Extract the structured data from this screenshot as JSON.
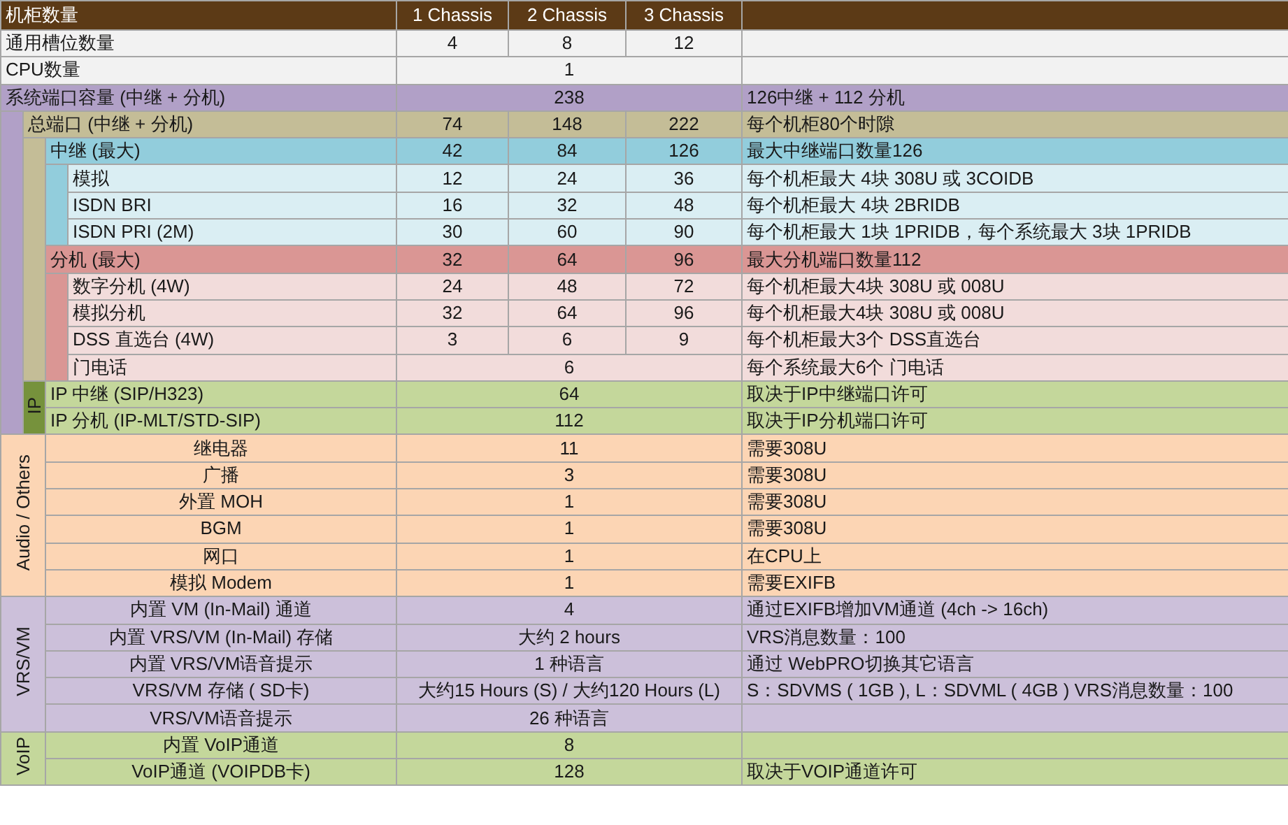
{
  "header": {
    "title": "机柜数量",
    "columns": [
      "1 Chassis",
      "2 Chassis",
      "3 Chassis"
    ]
  },
  "rows": [
    {
      "label": "通用槽位数量",
      "values": [
        "4",
        "8",
        "12"
      ],
      "color": "#f2f2f2"
    },
    {
      "label": "CPU数量",
      "values": [
        "1"
      ],
      "color": "#f2f2f2"
    },
    {
      "label": "系统端口容量 (中继 + 分机)",
      "values": [
        "238"
      ],
      "note": "126中继  + 112 分机",
      "color": "#b1a0c7",
      "children": [
        {
          "label": "总端口 (中继 + 分机)",
          "values": [
            "74",
            "148",
            "222"
          ],
          "note": "每个机柜80个时隙",
          "color": "#c4bd97",
          "children": [
            {
              "label": "中继 (最大)",
              "values": [
                "42",
                "84",
                "126"
              ],
              "note": "最大中继端口数量126",
              "color": "#92cddc",
              "children": [
                {
                  "label": "模拟",
                  "values": [
                    "12",
                    "24",
                    "36"
                  ],
                  "note": "每个机柜最大  4块 308U 或 3COIDB",
                  "color": "#daeef3"
                },
                {
                  "label": "ISDN BRI",
                  "values": [
                    "16",
                    "32",
                    "48"
                  ],
                  "note": "每个机柜最大  4块 2BRIDB",
                  "color": "#daeef3"
                },
                {
                  "label": "ISDN PRI (2M)",
                  "values": [
                    "30",
                    "60",
                    "90"
                  ],
                  "note": "每个机柜最大  1块 1PRIDB，每个系统最大  3块 1PRIDB",
                  "color": "#daeef3"
                }
              ]
            },
            {
              "label": "分机 (最大)",
              "values": [
                "32",
                "64",
                "96"
              ],
              "note": "最大分机端口数量112",
              "color": "#da9694",
              "children": [
                {
                  "label": "数字分机 (4W)",
                  "values": [
                    "24",
                    "48",
                    "72"
                  ],
                  "note": "每个机柜最大4块  308U 或 008U",
                  "color": "#f2dcdb"
                },
                {
                  "label": "模拟分机",
                  "values": [
                    "32",
                    "64",
                    "96"
                  ],
                  "note": "每个机柜最大4块  308U 或 008U",
                  "color": "#f2dcdb"
                },
                {
                  "label": "DSS 直选台 (4W)",
                  "values": [
                    "3",
                    "6",
                    "9"
                  ],
                  "note": "每个机柜最大3个  DSS直选台",
                  "color": "#f2dcdb"
                },
                {
                  "label": "门电话",
                  "values": [
                    "6"
                  ],
                  "note": "每个系统最大6个  门电话",
                  "color": "#f2dcdb"
                }
              ]
            }
          ]
        },
        {
          "kind": "group",
          "band_label": "IP",
          "color": "#76923c",
          "children": [
            {
              "label": "IP 中继 (SIP/H323)",
              "values": [
                "64"
              ],
              "note": "取决于IP中继端口许可",
              "color": "#c4d79b"
            },
            {
              "label": "IP 分机 (IP-MLT/STD-SIP)",
              "values": [
                "112"
              ],
              "note": "取决于IP分机端口许可",
              "color": "#c4d79b"
            }
          ]
        }
      ]
    },
    {
      "kind": "section",
      "band_label": "Audio / Others",
      "color": "#fcd5b4",
      "children": [
        {
          "label": "继电器",
          "values": [
            "11"
          ],
          "note": "需要308U",
          "color": "#fcd5b4"
        },
        {
          "label": "广播",
          "values": [
            "3"
          ],
          "note": "需要308U",
          "color": "#fcd5b4"
        },
        {
          "label": "外置 MOH",
          "values": [
            "1"
          ],
          "note": "需要308U",
          "color": "#fcd5b4"
        },
        {
          "label": "BGM",
          "values": [
            "1"
          ],
          "note": "需要308U",
          "color": "#fcd5b4"
        },
        {
          "label": "网口",
          "values": [
            "1"
          ],
          "note": "在CPU上",
          "color": "#fcd5b4"
        },
        {
          "label": "模拟 Modem",
          "values": [
            "1"
          ],
          "note": "需要EXIFB",
          "color": "#fcd5b4"
        }
      ]
    },
    {
      "kind": "section",
      "band_label": "VRS/VM",
      "color": "#ccc0da",
      "children": [
        {
          "label": "内置 VM (In-Mail) 通道",
          "values": [
            "4"
          ],
          "note": "通过EXIFB增加VM通道 (4ch -> 16ch)",
          "color": "#ccc0da"
        },
        {
          "label": "内置 VRS/VM (In-Mail) 存储",
          "values": [
            "大约 2 hours"
          ],
          "note": "VRS消息数量：100",
          "color": "#ccc0da"
        },
        {
          "label": "内置 VRS/VM语音提示",
          "values": [
            "1 种语言"
          ],
          "note": "通过 WebPRO切换其它语言",
          "color": "#ccc0da"
        },
        {
          "label": "VRS/VM 存储 ( SD卡)",
          "values": [
            "大约15 Hours (S) / 大约120 Hours (L)"
          ],
          "note": "S：SDVMS ( 1GB ), L：SDVML ( 4GB )    VRS消息数量：100",
          "color": "#ccc0da"
        },
        {
          "label": "VRS/VM语音提示",
          "values": [
            "26 种语言"
          ],
          "color": "#ccc0da"
        }
      ]
    },
    {
      "kind": "section",
      "band_label": "VoIP",
      "color": "#c4d79b",
      "children": [
        {
          "label": "内置 VoIP通道",
          "values": [
            "8"
          ],
          "color": "#c4d79b"
        },
        {
          "label": "VoIP通道 (VOIPDB卡)",
          "values": [
            "128"
          ],
          "note": "取决于VOIP通道许可",
          "color": "#c4d79b"
        }
      ]
    }
  ]
}
